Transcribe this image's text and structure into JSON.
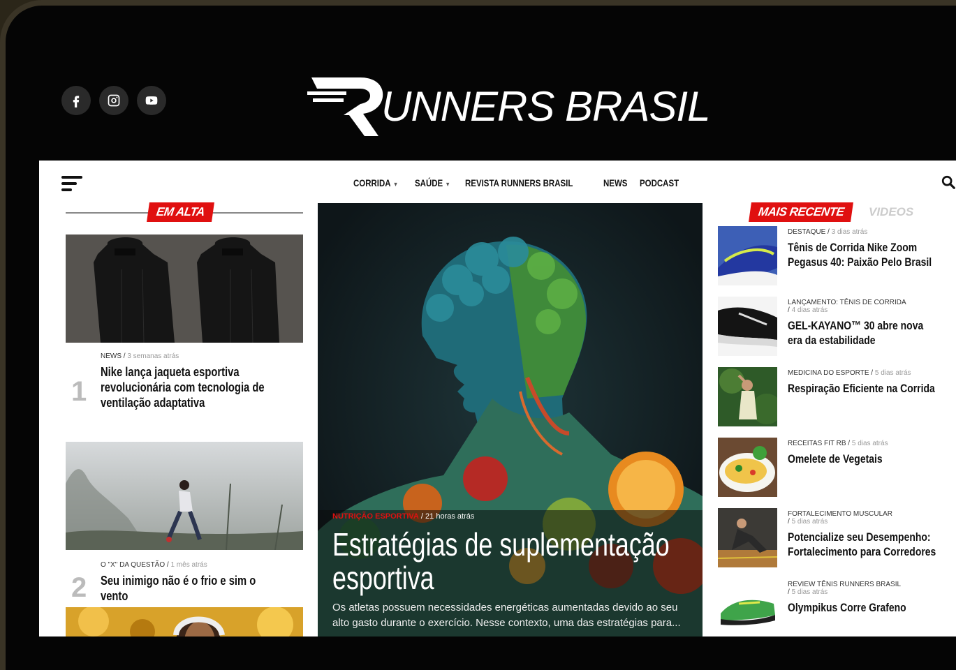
{
  "brand": {
    "name": "UNNERS BRASIL"
  },
  "social": [
    {
      "name": "facebook-icon"
    },
    {
      "name": "instagram-icon"
    },
    {
      "name": "youtube-icon"
    }
  ],
  "nav": {
    "items": [
      {
        "label": "CORRIDA",
        "dropdown": true
      },
      {
        "label": "SAÚDE",
        "dropdown": true
      },
      {
        "label": "REVISTA RUNNERS BRASIL",
        "dropdown": false
      },
      {
        "label": "NEWS",
        "dropdown": false
      },
      {
        "label": "PODCAST",
        "dropdown": false
      }
    ]
  },
  "trending": {
    "label": "EM ALTA",
    "articles": [
      {
        "rank": "1",
        "category": "NEWS",
        "time": "3 semanas atrás",
        "title": "Nike lança jaqueta esportiva revolucionária com tecnologia de ventilação adaptativa"
      },
      {
        "rank": "2",
        "category": "O \"X\" DA QUESTÃO",
        "time": "1 mês atrás",
        "title": "Seu inimigo não é o frio e sim o vento"
      }
    ]
  },
  "hero": {
    "category": "NUTRIÇÃO ESPORTIVA",
    "time": "21 horas atrás",
    "title": "Estratégias de suplementação esportiva",
    "excerpt": "Os atletas possuem necessidades energéticas aumentadas devido ao seu alto gasto durante o exercício. Nesse contexto, uma das estratégias para..."
  },
  "sidebar": {
    "tab_active": "MAIS RECENTE",
    "tab_inactive": "VIDEOS",
    "articles": [
      {
        "category": "DESTAQUE",
        "time": "3 dias atrás",
        "title": "Tênis de Corrida Nike Zoom Pegasus 40: Paixão Pelo Brasil"
      },
      {
        "category": "LANÇAMENTO: TÊNIS DE CORRIDA",
        "time": "4 dias atrás",
        "title": "GEL-KAYANO™ 30 abre nova era da estabilidade"
      },
      {
        "category": "MEDICINA DO ESPORTE",
        "time": "5 dias atrás",
        "title": "Respiração Eficiente na Corrida"
      },
      {
        "category": "RECEITAS FIT RB",
        "time": "5 dias atrás",
        "title": "Omelete de Vegetais"
      },
      {
        "category": "FORTALECIMENTO MUSCULAR",
        "time": "5 dias atrás",
        "title": "Potencialize seu Desempenho: Fortalecimento para Corredores"
      },
      {
        "category": "REVIEW TÊNIS RUNNERS BRASIL",
        "time": "5 dias atrás",
        "title": "Olympikus Corre Grafeno"
      }
    ]
  }
}
